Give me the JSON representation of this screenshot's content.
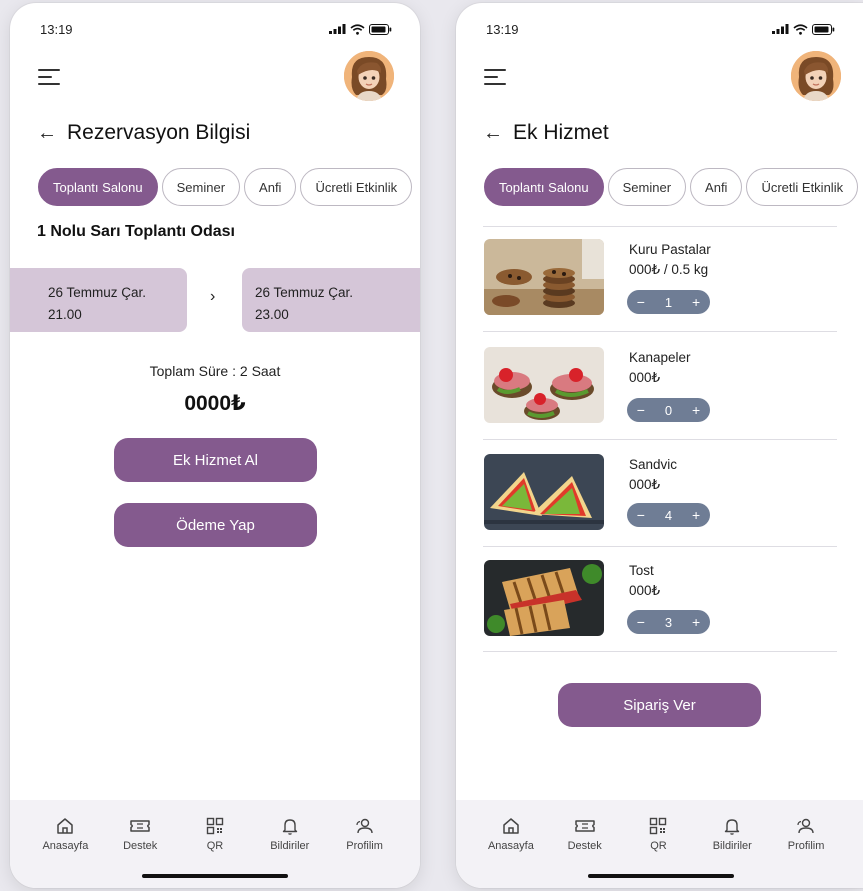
{
  "status": {
    "time": "13:19"
  },
  "tabs": [
    {
      "label": "Toplantı Salonu"
    },
    {
      "label": "Seminer"
    },
    {
      "label": "Anfi"
    },
    {
      "label": "Ücretli Etkinlik"
    }
  ],
  "left_screen": {
    "title": "Rezervasyon Bilgisi",
    "room_name": "1 Nolu Sarı Toplantı Odası",
    "start": {
      "date": "26 Temmuz Çar.",
      "time": "21.00"
    },
    "end": {
      "date": "26 Temmuz Çar.",
      "time": "23.00"
    },
    "duration": "Toplam Süre : 2 Saat",
    "price": "0000₺",
    "extra_service_button": "Ek Hizmet Al",
    "payment_button": "Ödeme Yap"
  },
  "right_screen": {
    "title": "Ek Hizmet",
    "products": [
      {
        "name": "Kuru Pastalar",
        "price": "000₺ / 0.5 kg",
        "quantity": "1"
      },
      {
        "name": "Kanapeler",
        "price": "000₺",
        "quantity": "0"
      },
      {
        "name": "Sandvic",
        "price": "000₺",
        "quantity": "4"
      },
      {
        "name": "Tost",
        "price": "000₺",
        "quantity": "3"
      }
    ],
    "order_button": "Sipariş Ver"
  },
  "bottom_nav": [
    {
      "label": "Anasayfa",
      "icon": "home-icon"
    },
    {
      "label": "Destek",
      "icon": "ticket-icon"
    },
    {
      "label": "QR",
      "icon": "qr-icon"
    },
    {
      "label": "Bildiriler",
      "icon": "bell-icon"
    },
    {
      "label": "Profilim",
      "icon": "profile-icon"
    }
  ],
  "colors": {
    "accent": "#845a8e",
    "date_box": "#d5c6d8",
    "stepper": "#6f7d95",
    "nav_bg": "#f3f2f6"
  }
}
